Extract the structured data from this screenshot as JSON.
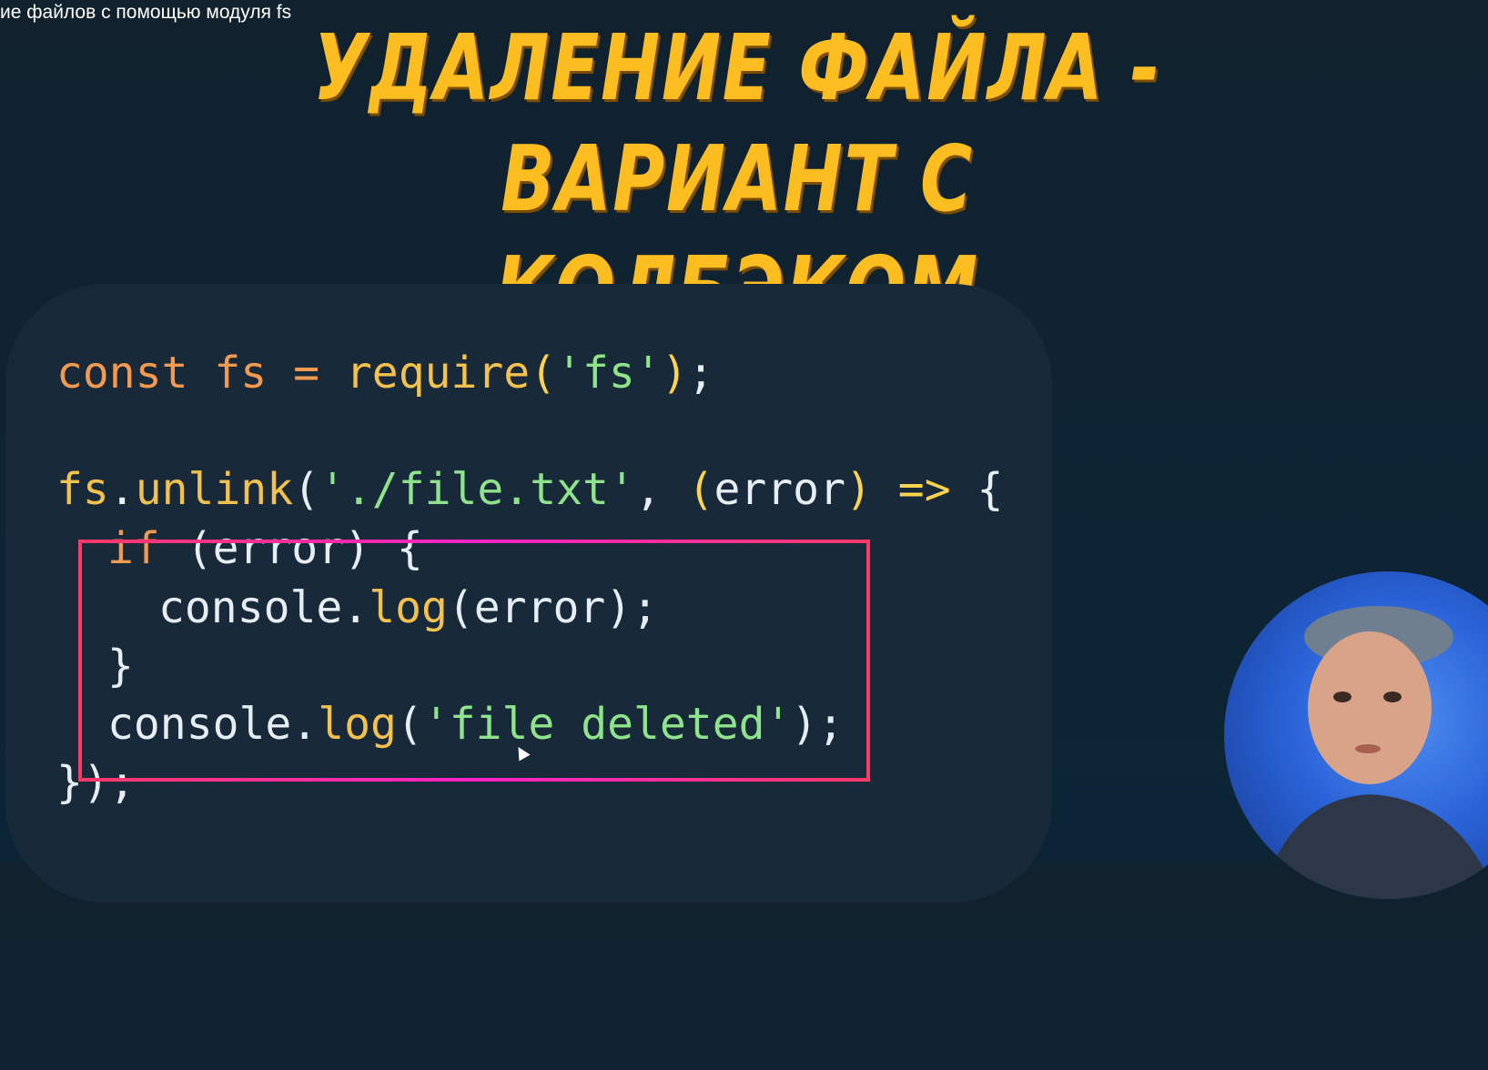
{
  "video": {
    "title": "ие файлов с помощью модуля fs"
  },
  "slide": {
    "title_line1": "УДАЛЕНИЕ ФАЙЛА - ВАРИАНТ С",
    "title_line2": "КОЛБЭКОМ"
  },
  "code": {
    "line1": {
      "kw": "const",
      "id": "fs",
      "eq": " = ",
      "fn": "require",
      "open": "(",
      "str": "'fs'",
      "close": ")",
      "semi": ";"
    },
    "line3": {
      "obj": "fs",
      "dot": ".",
      "fn": "unlink",
      "open": "(",
      "str": "'./file.txt'",
      "comma": ", ",
      "popen": "(",
      "arg": "error",
      "pclose": ")",
      "arrow": " => ",
      "brace": "{"
    },
    "line4": {
      "kw": "if",
      "rest": " (error) {"
    },
    "line5": {
      "obj": "console",
      "dot": ".",
      "fn": "log",
      "rest": "(error);"
    },
    "line6": {
      "brace": "}"
    },
    "line7": {
      "obj": "console",
      "dot": ".",
      "fn": "log",
      "open": "(",
      "str": "'file deleted'",
      "close": ");"
    },
    "line8": {
      "end": "});"
    }
  },
  "colors": {
    "title": "#fcbd20",
    "keyword": "#f29a4f",
    "string": "#8fe38a",
    "highlight_border": "#ff22c8"
  }
}
